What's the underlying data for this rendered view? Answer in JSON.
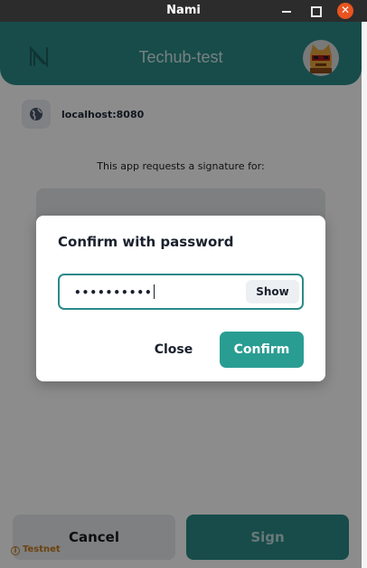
{
  "window": {
    "title": "Nami",
    "close_glyph": "✕"
  },
  "header": {
    "title": "Techub-test",
    "logo_icon": "nami-logo-icon",
    "avatar_icon": "cat-avatar-icon"
  },
  "origin": {
    "text": "localhost:8080",
    "icon": "globe-icon"
  },
  "request": {
    "text": "This app requests a signature for:"
  },
  "actions": {
    "cancel_label": "Cancel",
    "sign_label": "Sign"
  },
  "network": {
    "label": "Testnet",
    "icon_glyph": "i"
  },
  "modal": {
    "title": "Confirm with password",
    "password_value": "••••••••••",
    "show_label": "Show",
    "close_label": "Close",
    "confirm_label": "Confirm"
  },
  "colors": {
    "accent": "#2b8a88",
    "confirm": "#2a9d93",
    "testnet": "#c47a1c",
    "close_button": "#e95420"
  }
}
